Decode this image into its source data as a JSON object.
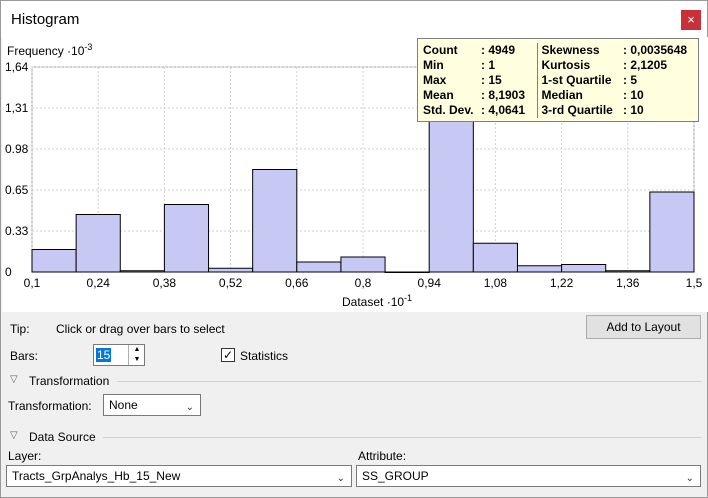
{
  "window": {
    "title": "Histogram",
    "close_glyph": "×"
  },
  "chart_data": {
    "type": "bar",
    "ylabel_prefix": "Frequency",
    "ylabel_exp": "-3",
    "xlabel_prefix": "Dataset",
    "xlabel_exp": "-1",
    "x_range": [
      0.1,
      1.5
    ],
    "y_range": [
      0,
      1.64
    ],
    "x_ticks": [
      "0,1",
      "0,24",
      "0,38",
      "0,52",
      "0,66",
      "0,8",
      "0,94",
      "1,08",
      "1,22",
      "1,36",
      "1,5"
    ],
    "y_ticks": [
      "0",
      "0.33",
      "0.65",
      "0.98",
      "1,31",
      "1,64"
    ],
    "bins": 15,
    "values": [
      0.18,
      0.46,
      0.01,
      0.54,
      0.03,
      0.82,
      0.08,
      0.12,
      0.0,
      1.66,
      0.23,
      0.05,
      0.06,
      0.01,
      0.64
    ],
    "bar_color": "#c8c8f5",
    "selected_bin": 9
  },
  "stats": {
    "count_label": "Count",
    "count": ": 4949",
    "min_label": "Min",
    "min": ": 1",
    "max_label": "Max",
    "max": ": 15",
    "mean_label": "Mean",
    "mean": ": 8,1903",
    "std_label": "Std. Dev.",
    "std": ": 4,0641",
    "skew_label": "Skewness",
    "skew": ": 0,0035648",
    "kurt_label": "Kurtosis",
    "kurt": ": 2,1205",
    "q1_label": "1-st Quartile",
    "q1": ": 5",
    "median_label": "Median",
    "median": ": 10",
    "q3_label": "3-rd Quartile",
    "q3": ": 10"
  },
  "controls": {
    "tip_label": "Tip:",
    "tip_text": "Click or drag over bars to select",
    "add_to_layout": "Add to Layout",
    "bars_label": "Bars:",
    "bars_value": "15",
    "statistics_label": "Statistics",
    "statistics_checked": "✓",
    "transformation_section": "Transformation",
    "transformation_label": "Transformation:",
    "transformation_value": "None",
    "data_source_section": "Data Source",
    "layer_label": "Layer:",
    "layer_value": "Tracts_GrpAnalys_Hb_15_New",
    "attribute_label": "Attribute:",
    "attribute_value": "SS_GROUP"
  }
}
